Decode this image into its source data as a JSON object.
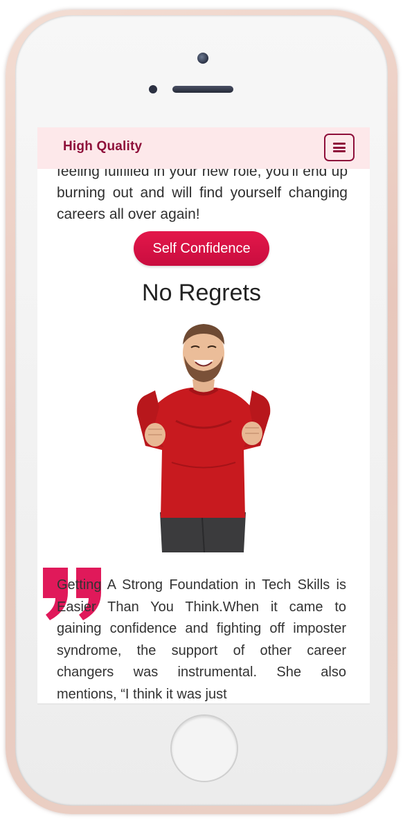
{
  "navbar": {
    "brand": "High Quality",
    "menu_icon": "hamburger-menu-icon"
  },
  "article": {
    "intro_text": "feeling fulfilled in your new role, you'll end up burning out and will find yourself changing careers all over again!",
    "tag_button": "Self Confidence",
    "heading": "No Regrets",
    "body_text": "Getting A Strong Foundation in Tech Skills is Easier Than You Think.When it came to gaining confidence and fighting off imposter syndrome, the support of other career changers was instrumental. She also mentions, “I think it was just"
  },
  "colors": {
    "brand": "#8e0f3a",
    "navbar_bg": "#fde8ea",
    "accent": "#d9114a",
    "quote": "#e0195a"
  },
  "icons": {
    "quote": "closing-quote-icon",
    "hero": "celebrating-man-image"
  }
}
